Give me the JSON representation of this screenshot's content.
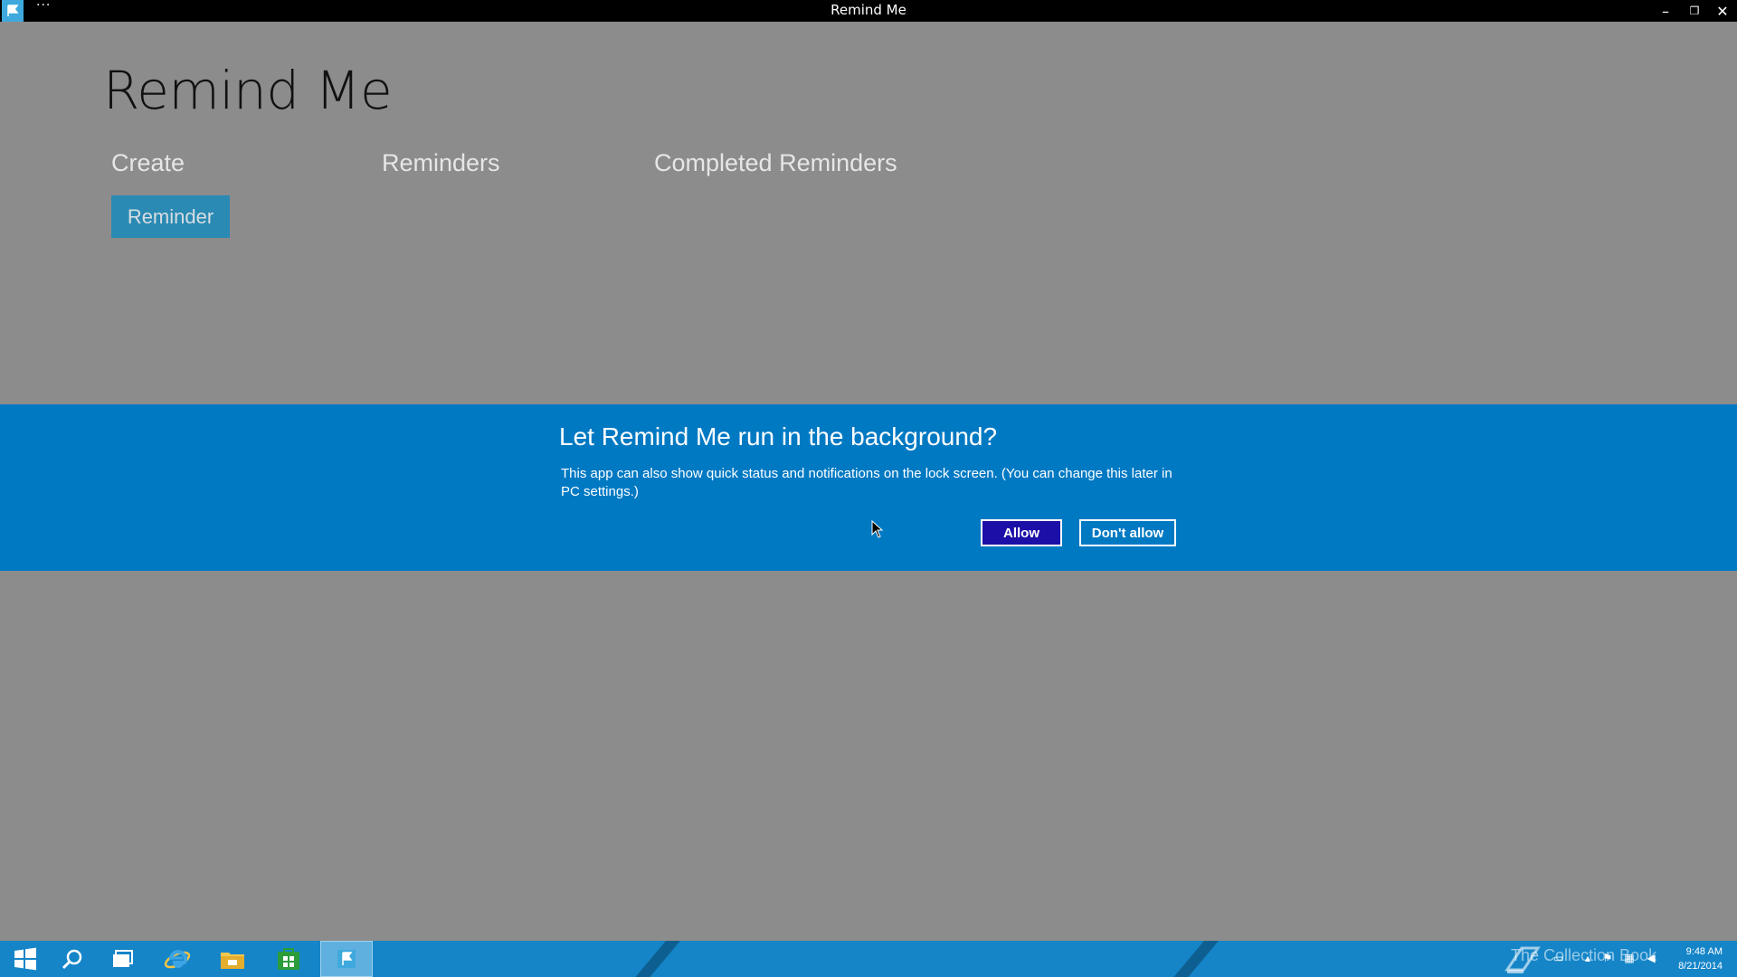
{
  "window": {
    "title": "Remind Me",
    "menu_label": "···",
    "minimize_glyph": "–",
    "restore_glyph": "❐",
    "close_glyph": "✕"
  },
  "app": {
    "title": "Remind Me",
    "tabs": [
      {
        "label": "Create"
      },
      {
        "label": "Reminders"
      },
      {
        "label": "Completed Reminders"
      }
    ],
    "reminder_button_label": "Reminder"
  },
  "banner": {
    "heading": "Let Remind Me run in the background?",
    "body": "This app can also show quick status and notifications on the lock screen. (You can change this later in PC settings.)",
    "allow_label": "Allow",
    "dont_allow_label": "Don't allow"
  },
  "taskbar": {
    "items": [
      {
        "icon": "start-icon"
      },
      {
        "icon": "search-icon"
      },
      {
        "icon": "task-view-icon"
      },
      {
        "icon": "internet-explorer-icon"
      },
      {
        "icon": "file-explorer-icon"
      },
      {
        "icon": "store-icon"
      },
      {
        "icon": "remind-me-icon",
        "active": true
      }
    ],
    "watermark": "The Collection Book",
    "time": "9:48 AM",
    "date": "8/21/2014"
  },
  "colors": {
    "background": "#8c8c8c",
    "banner": "#0079c3",
    "allow_button": "#1c0fa8",
    "taskbar": "#1585c8",
    "reminder_button": "#2a8ab3"
  }
}
